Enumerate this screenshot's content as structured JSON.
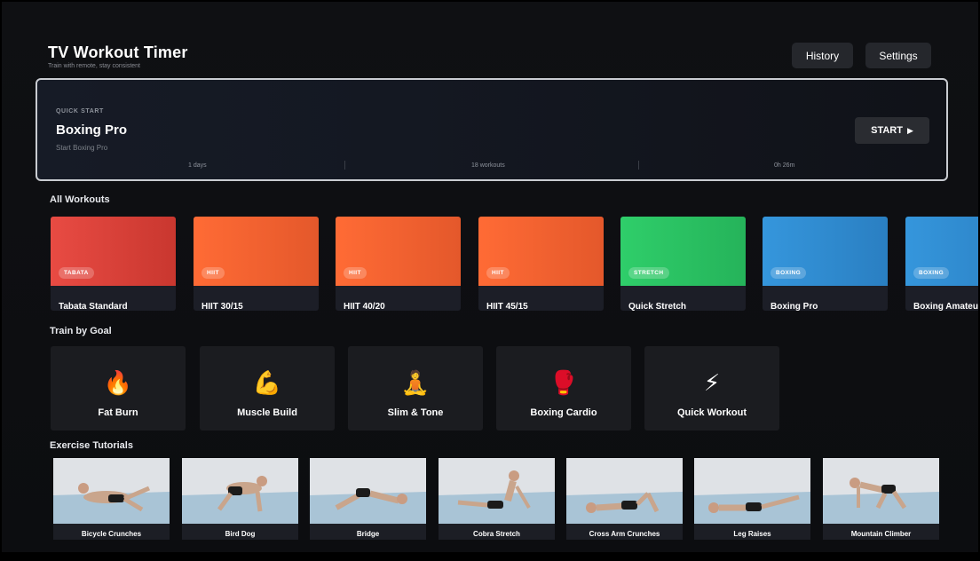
{
  "header": {
    "title": "TV Workout Timer",
    "subtitle": "Train with remote, stay consistent",
    "history_label": "History",
    "settings_label": "Settings"
  },
  "quick_start": {
    "label": "QUICK START",
    "title": "Boxing Pro",
    "subtitle": "Start Boxing Pro",
    "start_label": "START",
    "start_icon": "play-icon",
    "stats": [
      "1 days",
      "18 workouts",
      "0h 26m"
    ]
  },
  "all_workouts": {
    "title": "All Workouts",
    "items": [
      {
        "name": "Tabata Standard",
        "badge": "TABATA",
        "color_a": "#e84b43",
        "color_b": "#c9372f"
      },
      {
        "name": "HIIT 30/15",
        "badge": "HIIT",
        "color_a": "#ff6b35",
        "color_b": "#e4582b"
      },
      {
        "name": "HIIT 40/20",
        "badge": "HIIT",
        "color_a": "#ff6b35",
        "color_b": "#e4582b"
      },
      {
        "name": "HIIT 45/15",
        "badge": "HIIT",
        "color_a": "#ff6b35",
        "color_b": "#e4582b"
      },
      {
        "name": "Quick Stretch",
        "badge": "STRETCH",
        "color_a": "#2fce6a",
        "color_b": "#25b35a"
      },
      {
        "name": "Boxing Pro",
        "badge": "BOXING",
        "color_a": "#3596dc",
        "color_b": "#2a7fc2"
      },
      {
        "name": "Boxing Amateur",
        "badge": "BOXING",
        "color_a": "#3596dc",
        "color_b": "#2a7fc2"
      }
    ]
  },
  "goals": {
    "title": "Train by Goal",
    "items": [
      {
        "label": "Fat Burn",
        "emoji": "🔥",
        "icon": "fire-icon"
      },
      {
        "label": "Muscle Build",
        "emoji": "💪",
        "icon": "flexed-biceps-icon"
      },
      {
        "label": "Slim & Tone",
        "emoji": "🧘",
        "icon": "yoga-icon"
      },
      {
        "label": "Boxing Cardio",
        "emoji": "🥊",
        "icon": "boxing-glove-icon"
      },
      {
        "label": "Quick Workout",
        "emoji": "⚡",
        "icon": "lightning-icon"
      }
    ]
  },
  "tutorials": {
    "title": "Exercise Tutorials",
    "items": [
      {
        "label": "Bicycle Crunches"
      },
      {
        "label": "Bird Dog"
      },
      {
        "label": "Bridge"
      },
      {
        "label": "Cobra Stretch"
      },
      {
        "label": "Cross Arm Crunches"
      },
      {
        "label": "Leg Raises"
      },
      {
        "label": "Mountain Climber"
      }
    ]
  },
  "colors": {
    "background": "#0e0f12",
    "card": "#1b1c20",
    "focus_border": "#c9ccd1"
  }
}
